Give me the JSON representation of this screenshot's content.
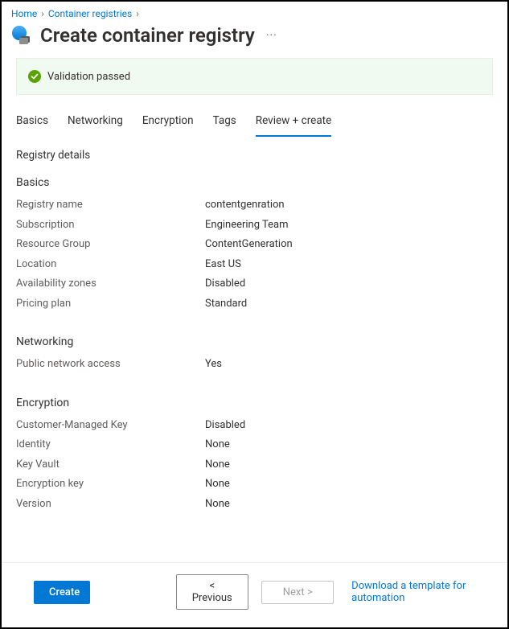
{
  "breadcrumb": {
    "home": "Home",
    "registries": "Container registries"
  },
  "page": {
    "title": "Create container registry"
  },
  "validation": {
    "message": "Validation passed"
  },
  "tabs": {
    "basics": "Basics",
    "networking": "Networking",
    "encryption": "Encryption",
    "tags": "Tags",
    "review": "Review + create"
  },
  "heading": {
    "details": "Registry details"
  },
  "sections": {
    "basics": {
      "title": "Basics",
      "rows": {
        "registry_name": {
          "label": "Registry name",
          "value": "contentgenration"
        },
        "subscription": {
          "label": "Subscription",
          "value": "Engineering Team"
        },
        "resource_group": {
          "label": "Resource Group",
          "value": "ContentGeneration"
        },
        "location": {
          "label": "Location",
          "value": "East US"
        },
        "availability_zones": {
          "label": "Availability zones",
          "value": "Disabled"
        },
        "pricing_plan": {
          "label": "Pricing plan",
          "value": "Standard"
        }
      }
    },
    "networking": {
      "title": "Networking",
      "rows": {
        "public_access": {
          "label": "Public network access",
          "value": "Yes"
        }
      }
    },
    "encryption": {
      "title": "Encryption",
      "rows": {
        "cmk": {
          "label": "Customer-Managed Key",
          "value": "Disabled"
        },
        "identity": {
          "label": "Identity",
          "value": "None"
        },
        "key_vault": {
          "label": "Key Vault",
          "value": "None"
        },
        "encryption_key": {
          "label": "Encryption key",
          "value": "None"
        },
        "version": {
          "label": "Version",
          "value": "None"
        }
      }
    }
  },
  "footer": {
    "create": "Create",
    "previous": "< Previous",
    "next": "Next >",
    "download": "Download a template for automation"
  }
}
